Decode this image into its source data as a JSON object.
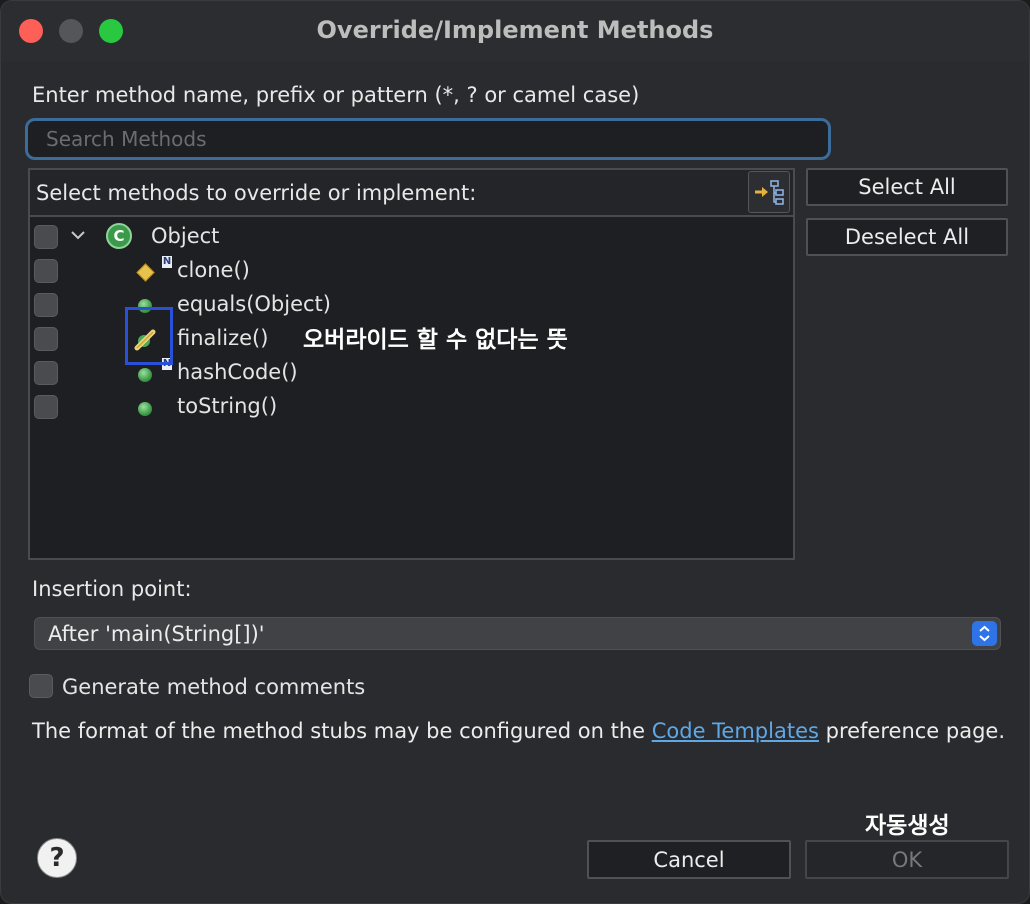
{
  "window": {
    "title": "Override/Implement Methods"
  },
  "filter": {
    "label": "Enter method name, prefix or pattern (*, ? or camel case)",
    "placeholder": "Search Methods",
    "value": ""
  },
  "tree": {
    "header": "Select methods to override or implement:",
    "class_node": {
      "label": "Object",
      "icon": "class-c-icon",
      "checked": false,
      "expanded": true
    },
    "methods": [
      {
        "label": "clone()",
        "icon": "protected-diamond-icon",
        "checked": false,
        "badge": "N"
      },
      {
        "label": "equals(Object)",
        "icon": "public-method-icon",
        "checked": false
      },
      {
        "label": "finalize()",
        "icon": "deprecated-method-icon",
        "checked": false
      },
      {
        "label": "hashCode()",
        "icon": "public-method-icon",
        "checked": false,
        "badge": "N"
      },
      {
        "label": "toString()",
        "icon": "public-method-icon",
        "checked": false
      }
    ],
    "annotation": "오버라이드 할 수 없다는 뜻"
  },
  "side_buttons": {
    "select_all": "Select All",
    "deselect_all": "Deselect All"
  },
  "insertion": {
    "label": "Insertion point:",
    "selected": "After 'main(String[])'"
  },
  "comments": {
    "label": "Generate method comments",
    "checked": false
  },
  "format": {
    "prefix": "The format of the method stubs may be configured on the ",
    "link": "Code Templates",
    "suffix": " preference page."
  },
  "footer": {
    "help": "?",
    "annotation": "자동생성",
    "cancel": "Cancel",
    "ok": "OK"
  },
  "colors": {
    "accent": "#2e74e6",
    "link": "#5fa8e8",
    "focus_ring": "#3c6c9a",
    "annotation_box": "#2a4fd8"
  }
}
